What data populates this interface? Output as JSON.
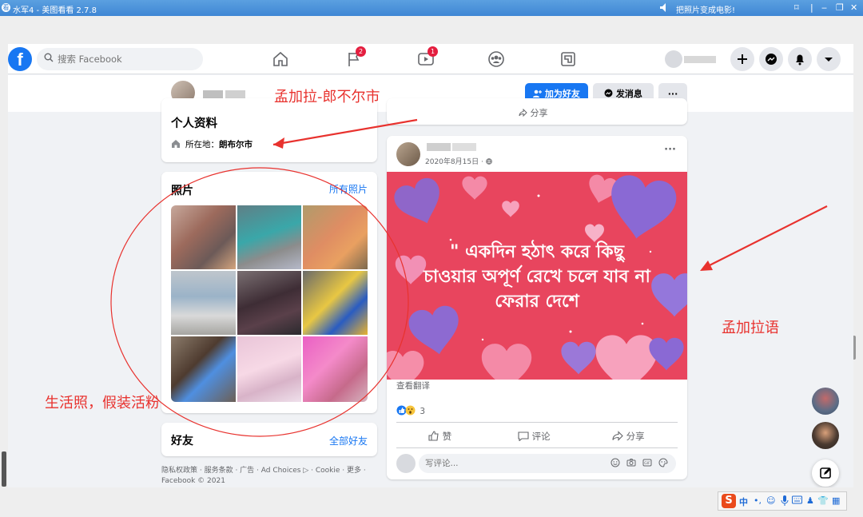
{
  "viewer": {
    "title": "水军4 - 美图看看 2.7.8",
    "notice": "把照片变成电影!",
    "ctrl_pin": "⌑",
    "ctrl_min": "‒",
    "ctrl_max": "❐",
    "ctrl_close": "✕"
  },
  "navbar": {
    "logo": "f",
    "search_placeholder": "搜索 Facebook",
    "badges": {
      "pages": "2",
      "watch": "1"
    }
  },
  "profile_header": {
    "add_friend": "加为好友",
    "message": "发消息",
    "more": "···"
  },
  "intro": {
    "title": "个人资料",
    "location_label": "所在地：",
    "location_value": "朗布尔市"
  },
  "photos": {
    "title": "照片",
    "see_all": "所有照片"
  },
  "friends": {
    "title": "好友",
    "see_all": "全部好友"
  },
  "legal": {
    "line1": "隐私权政策 · 服务条款 · 广告 · Ad Choices ▷ · Cookie · 更多 ·",
    "line2": "Facebook © 2021"
  },
  "top_card": {
    "share": "分享"
  },
  "post": {
    "date": "2020年8月15日 · ",
    "more": "···",
    "image_text_line1": "\" একদিন হঠাৎ করে কিছু",
    "image_text_line2": "চাওয়ার অপূর্ণ রেখে চলে যাব না",
    "image_text_line3": "ফেরার দেশে",
    "see_translation": "查看翻译",
    "reaction_count": "3",
    "like": "赞",
    "comment": "评论",
    "share": "分享",
    "comment_placeholder": "写评论..."
  },
  "annotations": {
    "city": "孟加拉-郎不尔市",
    "language": "孟加拉语",
    "life_photos": "生活照，假装活粉"
  },
  "ime": {
    "lang": "中"
  },
  "colors": {
    "fb_blue": "#1877f2",
    "annotation_red": "#e8322e",
    "post_bg": "#e8455e"
  }
}
